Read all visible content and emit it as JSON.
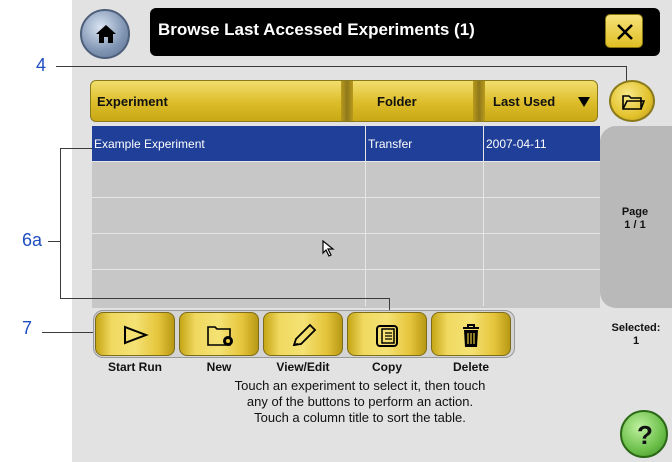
{
  "header": {
    "title": "Browse Last Accessed Experiments (1)",
    "home_icon": "home-icon",
    "close_icon": "close-x-icon"
  },
  "callouts": {
    "c4": "4",
    "c6a": "6a",
    "c7": "7"
  },
  "table": {
    "columns": [
      "Experiment",
      "Folder",
      "Last Used"
    ],
    "sort_icon": "sort-down-arrow-icon",
    "folder_icon": "open-folder-icon",
    "rows": [
      [
        "Example Experiment",
        "Transfer",
        "2007-04-11"
      ],
      [
        "",
        "",
        ""
      ],
      [
        "",
        "",
        ""
      ],
      [
        "",
        "",
        ""
      ],
      [
        "",
        "",
        ""
      ]
    ],
    "page_label": "Page",
    "page_value": "1 / 1"
  },
  "actions": [
    {
      "label": "Start Run",
      "icon": "play-outline-icon"
    },
    {
      "label": "New",
      "icon": "new-folder-gear-icon"
    },
    {
      "label": "View/Edit",
      "icon": "pencil-icon"
    },
    {
      "label": "Copy",
      "icon": "copy-icon"
    },
    {
      "label": "Delete",
      "icon": "trash-icon"
    }
  ],
  "selected": {
    "label": "Selected:",
    "value": "1"
  },
  "help_text": [
    "Touch an experiment to select it, then touch",
    "any of the buttons to perform an action.",
    "Touch a column title to sort the table."
  ],
  "help_button": "?",
  "colors": {
    "accent_yellow": "#e3c22c",
    "selection_blue": "#1f3f99",
    "panel_gray": "#e2e2e2",
    "callout_blue": "#1f4ec2"
  }
}
